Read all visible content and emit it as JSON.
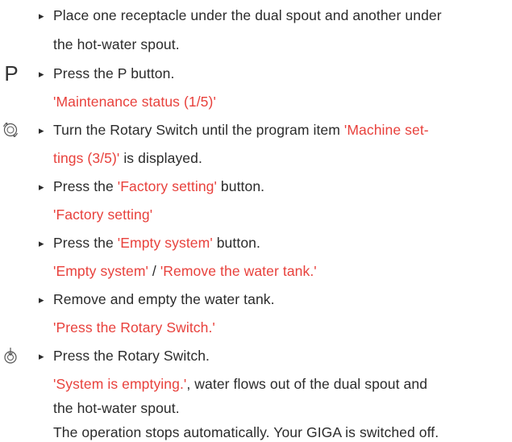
{
  "icons": {
    "p_letter": "P",
    "rotary_icon": "rotary-switch-icon",
    "press_icon": "press-rotary-switch-icon",
    "bullet": "▸"
  },
  "colors": {
    "text": "#2b2b2b",
    "display_text": "#e8413c"
  },
  "steps": {
    "s1": {
      "a": "Place one receptacle under the dual spout and another under",
      "b": "the hot-water spout."
    },
    "s2": {
      "a": "Press the P button.",
      "display": "'Maintenance status (1/5)'"
    },
    "s3": {
      "a_pre": "Turn the Rotary Switch until the program item ",
      "a_red": "'Machine set-",
      "b_red": "tings (3/5)'",
      "b_post": " is displayed."
    },
    "s4": {
      "pre": "Press the ",
      "red": "'Factory setting'",
      "post": " button.",
      "display": "'Factory setting'"
    },
    "s5": {
      "pre": "Press the ",
      "red": "'Empty system'",
      "post": " button.",
      "display_a": "'Empty system'",
      "sep": " / ",
      "display_b": "'Remove the water tank.'"
    },
    "s6": {
      "a": "Remove and empty the water tank.",
      "display": "'Press the Rotary Switch.'"
    },
    "s7": {
      "a": "Press the Rotary Switch.",
      "display": "'System is emptying.'",
      "cont_a": ", water flows out of the dual spout and",
      "cont_b": "the hot-water spout.",
      "note": "The operation stops automatically. Your GIGA is switched off."
    }
  }
}
